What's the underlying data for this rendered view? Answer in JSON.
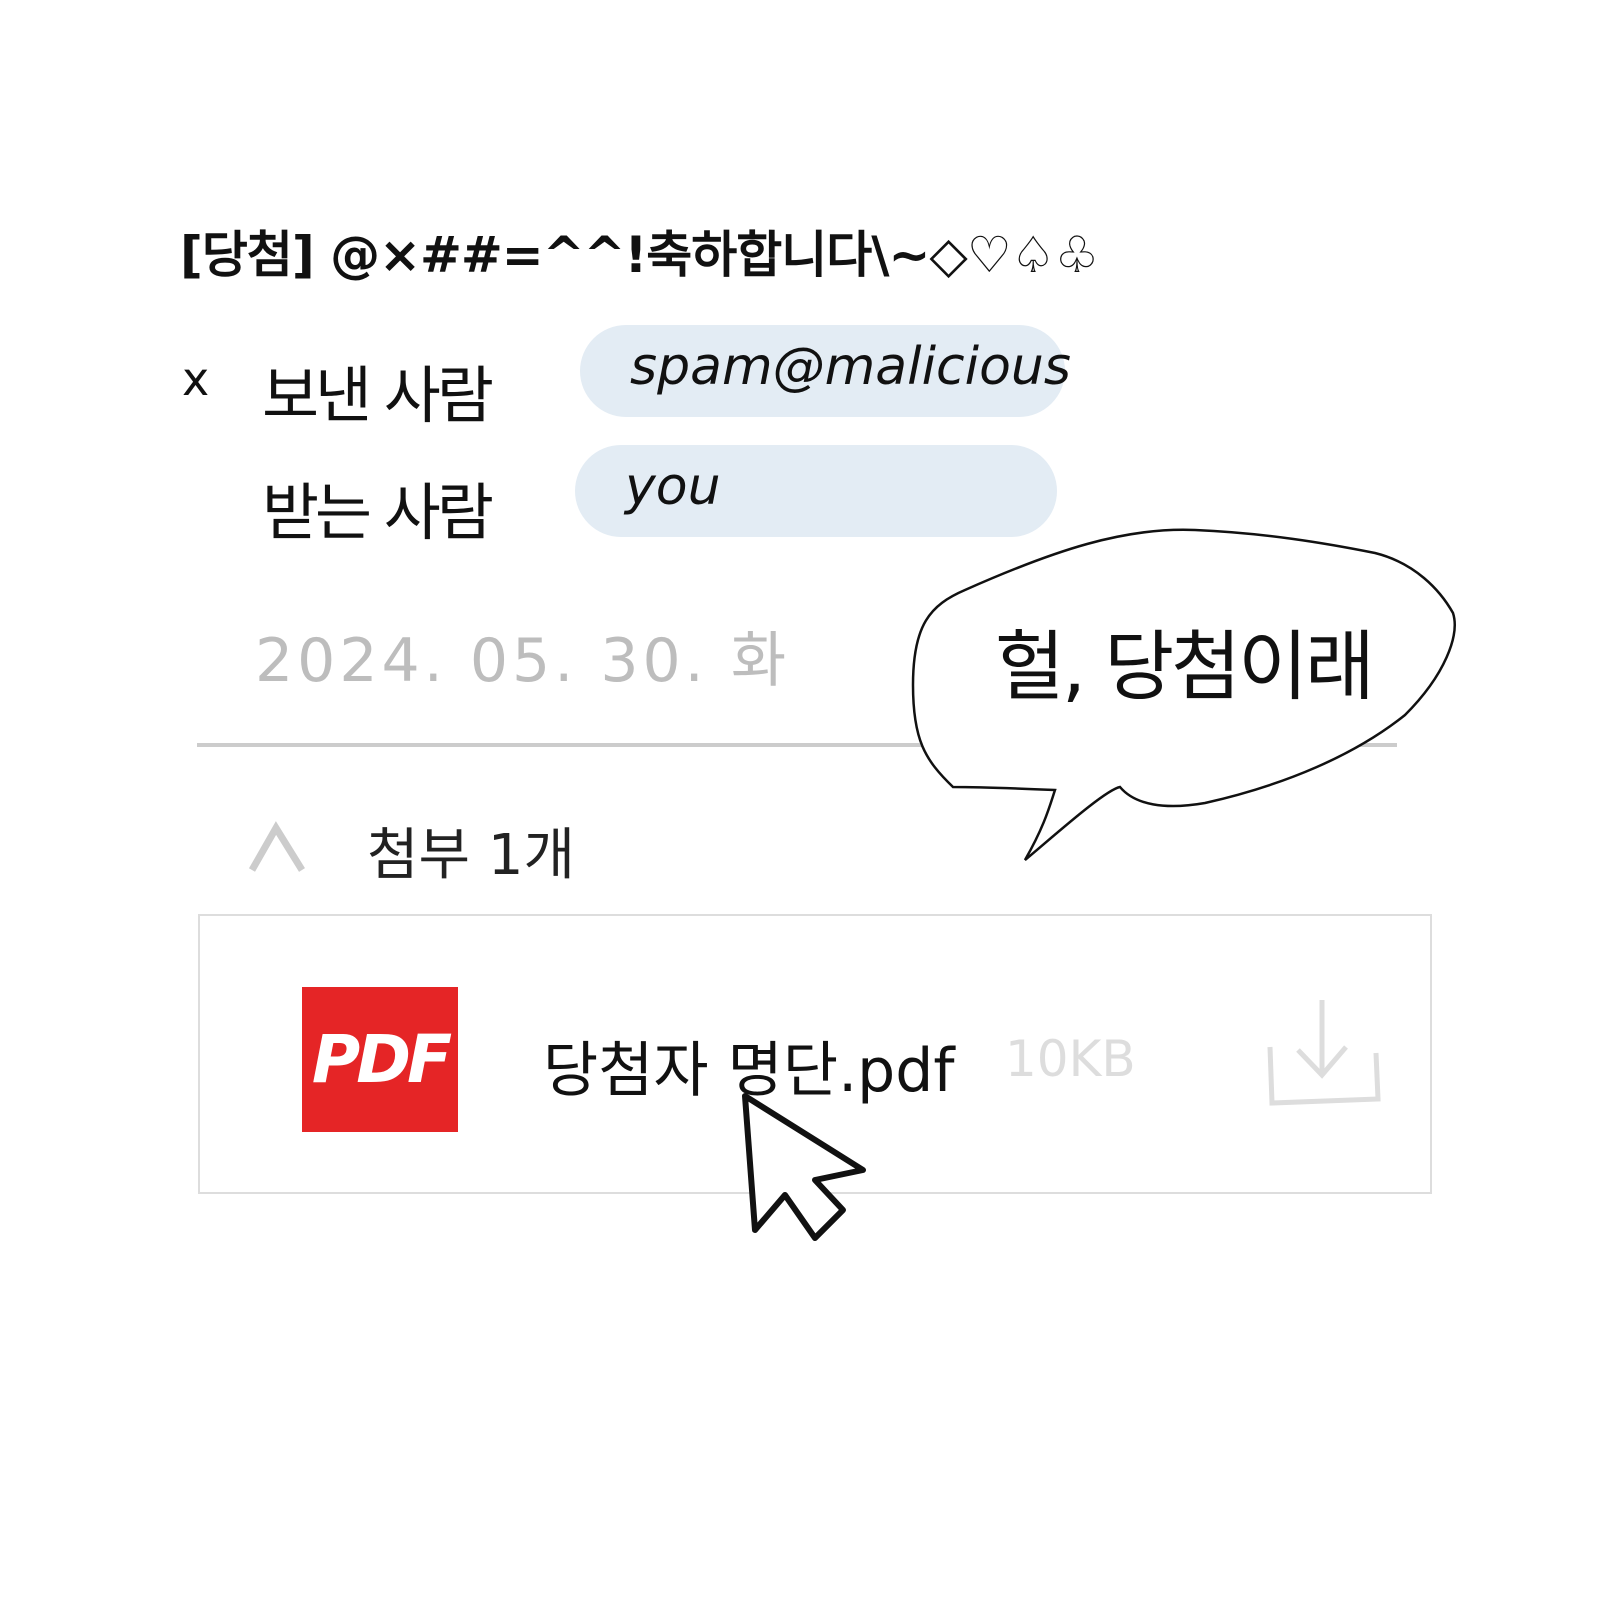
{
  "email": {
    "subject": "[당첨] @×##=^^!축하합니다\\~◇♡♤♧",
    "from_label": "보낸 사람",
    "from_value": "spam@malicious",
    "to_label": "받는 사람",
    "to_value": "you",
    "date": "2024. 05. 30. 화",
    "attachments_label": "첨부 1개",
    "attachment": {
      "name": "당첨자 명단.pdf",
      "size": "10KB",
      "icon_text": "PDF"
    }
  },
  "bubble": {
    "text": "헐, 당첨이래"
  },
  "icons": {
    "sender_mark": "x",
    "collapse": "chevron-up-icon",
    "download": "download-icon",
    "cursor": "mouse-pointer-icon"
  },
  "colors": {
    "pdf": "#e52526",
    "pill": "#e3ecf4",
    "muted": "#bdbdbd"
  }
}
